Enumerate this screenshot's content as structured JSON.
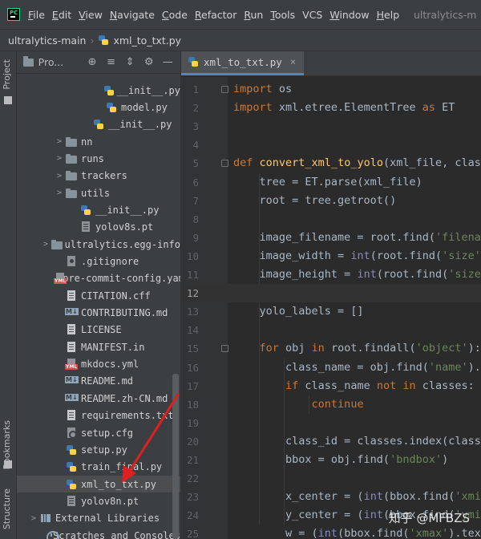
{
  "menubar": {
    "items": [
      {
        "mnemonic": "F",
        "rest": "ile"
      },
      {
        "mnemonic": "E",
        "rest": "dit"
      },
      {
        "mnemonic": "V",
        "rest": "iew"
      },
      {
        "mnemonic": "N",
        "rest": "avigate"
      },
      {
        "mnemonic": "C",
        "rest": "ode"
      },
      {
        "mnemonic": "R",
        "rest": "efactor"
      },
      {
        "mnemonic": "R",
        "rest": "un"
      },
      {
        "mnemonic": "T",
        "rest": "ools"
      },
      {
        "mnemonic": "",
        "rest": "VCS"
      },
      {
        "mnemonic": "W",
        "rest": "indow"
      },
      {
        "mnemonic": "H",
        "rest": "elp"
      }
    ],
    "window_title": "ultralytics-m"
  },
  "breadcrumbs": {
    "project": "ultralytics-main",
    "file": "xml_to_txt.py"
  },
  "left_strip": {
    "project": "Project",
    "bookmarks": "Bookmarks",
    "structure": "Structure"
  },
  "project_panel": {
    "title": "Pro...",
    "tree": [
      {
        "name": "__init__.py",
        "icon": "python-file-icon",
        "arrow": ""
      },
      {
        "name": "model.py",
        "icon": "python-file-icon",
        "arrow": ""
      },
      {
        "name": "__init__.py",
        "icon": "python-file-icon",
        "arrow": ""
      },
      {
        "name": "nn",
        "icon": "folder-icon",
        "arrow": ">"
      },
      {
        "name": "runs",
        "icon": "folder-icon",
        "arrow": ">"
      },
      {
        "name": "trackers",
        "icon": "folder-icon",
        "arrow": ">"
      },
      {
        "name": "utils",
        "icon": "folder-icon",
        "arrow": ">"
      },
      {
        "name": "__init__.py",
        "icon": "python-file-icon",
        "arrow": ""
      },
      {
        "name": "yolov8s.pt",
        "icon": "pt-file-icon",
        "arrow": ""
      },
      {
        "name": "ultralytics.egg-info",
        "icon": "folder-icon",
        "arrow": ">"
      },
      {
        "name": ".gitignore",
        "icon": "gitignore-icon",
        "arrow": ""
      },
      {
        "name": ".pre-commit-config.yaml",
        "icon": "yaml-file-icon",
        "arrow": ""
      },
      {
        "name": "CITATION.cff",
        "icon": "text-file-icon",
        "arrow": ""
      },
      {
        "name": "CONTRIBUTING.md",
        "icon": "markdown-file-icon",
        "arrow": ""
      },
      {
        "name": "LICENSE",
        "icon": "text-file-icon",
        "arrow": ""
      },
      {
        "name": "MANIFEST.in",
        "icon": "text-file-icon",
        "arrow": ""
      },
      {
        "name": "mkdocs.yml",
        "icon": "yaml-file-icon",
        "arrow": ""
      },
      {
        "name": "README.md",
        "icon": "markdown-file-icon",
        "arrow": ""
      },
      {
        "name": "README.zh-CN.md",
        "icon": "markdown-file-icon",
        "arrow": ""
      },
      {
        "name": "requirements.txt",
        "icon": "text-file-icon",
        "arrow": ""
      },
      {
        "name": "setup.cfg",
        "icon": "config-file-icon",
        "arrow": ""
      },
      {
        "name": "setup.py",
        "icon": "python-file-icon",
        "arrow": ""
      },
      {
        "name": "train_final.py",
        "icon": "python-file-icon",
        "arrow": ""
      },
      {
        "name": "xml_to_txt.py",
        "icon": "python-file-icon",
        "arrow": "",
        "selected": true
      },
      {
        "name": "yolov8n.pt",
        "icon": "pt-file-icon",
        "arrow": ""
      },
      {
        "name": "External Libraries",
        "icon": "library-icon",
        "arrow": ">"
      },
      {
        "name": "Scratches and Consoles",
        "icon": "scratch-icon",
        "arrow": ""
      }
    ]
  },
  "editor": {
    "tab": {
      "label": "xml_to_txt.py"
    },
    "current_line": 12,
    "lines": [
      {
        "n": "1",
        "tokens": [
          [
            "kw",
            "import"
          ],
          [
            "",
            " os"
          ]
        ]
      },
      {
        "n": "2",
        "tokens": [
          [
            "kw",
            "import"
          ],
          [
            "",
            " xml.etree.ElementTree "
          ],
          [
            "kw",
            "as"
          ],
          [
            "",
            " ET"
          ]
        ]
      },
      {
        "n": "3",
        "tokens": []
      },
      {
        "n": "4",
        "tokens": []
      },
      {
        "n": "5",
        "tokens": [
          [
            "kw",
            "def"
          ],
          [
            "",
            " "
          ],
          [
            "fn",
            "convert_xml_to_yolo"
          ],
          [
            "",
            "(xml_file, classe"
          ]
        ]
      },
      {
        "n": "6",
        "tokens": [
          [
            "",
            "    tree = ET.parse(xml_file)"
          ]
        ]
      },
      {
        "n": "7",
        "tokens": [
          [
            "",
            "    root = tree.getroot()"
          ]
        ]
      },
      {
        "n": "8",
        "tokens": []
      },
      {
        "n": "9",
        "tokens": [
          [
            "",
            "    image_filename = root.find("
          ],
          [
            "str",
            "'filename"
          ]
        ]
      },
      {
        "n": "10",
        "tokens": [
          [
            "",
            "    image_width = "
          ],
          [
            "builtin",
            "int"
          ],
          [
            "",
            "(root.find("
          ],
          [
            "str",
            "'size'"
          ],
          [
            "",
            ")."
          ]
        ]
      },
      {
        "n": "11",
        "tokens": [
          [
            "",
            "    image_height = "
          ],
          [
            "builtin",
            "int"
          ],
          [
            "",
            "(root.find("
          ],
          [
            "str",
            "'size'"
          ],
          [
            "",
            ")"
          ]
        ]
      },
      {
        "n": "12",
        "tokens": []
      },
      {
        "n": "13",
        "tokens": [
          [
            "",
            "    yolo_labels = []"
          ]
        ]
      },
      {
        "n": "14",
        "tokens": []
      },
      {
        "n": "15",
        "tokens": [
          [
            "",
            "    "
          ],
          [
            "kw",
            "for"
          ],
          [
            "",
            " obj "
          ],
          [
            "kw",
            "in"
          ],
          [
            "",
            " root.findall("
          ],
          [
            "str",
            "'object'"
          ],
          [
            "",
            "):"
          ]
        ]
      },
      {
        "n": "16",
        "tokens": [
          [
            "",
            "        class_name = obj.find("
          ],
          [
            "str",
            "'name'"
          ],
          [
            "",
            ").te"
          ]
        ]
      },
      {
        "n": "17",
        "tokens": [
          [
            "",
            "        "
          ],
          [
            "kw",
            "if"
          ],
          [
            "",
            " class_name "
          ],
          [
            "kw",
            "not in"
          ],
          [
            "",
            " classes:"
          ]
        ]
      },
      {
        "n": "18",
        "tokens": [
          [
            "",
            "            "
          ],
          [
            "kw",
            "continue"
          ]
        ]
      },
      {
        "n": "19",
        "tokens": []
      },
      {
        "n": "20",
        "tokens": [
          [
            "",
            "        class_id = classes.index(class_n"
          ]
        ]
      },
      {
        "n": "21",
        "tokens": [
          [
            "",
            "        bbox = obj.find("
          ],
          [
            "str",
            "'bndbox'"
          ],
          [
            "",
            ")"
          ]
        ]
      },
      {
        "n": "22",
        "tokens": []
      },
      {
        "n": "23",
        "tokens": [
          [
            "",
            "        x_center = ("
          ],
          [
            "builtin",
            "int"
          ],
          [
            "",
            "(bbox.find("
          ],
          [
            "str",
            "'xmin'"
          ]
        ]
      },
      {
        "n": "24",
        "tokens": [
          [
            "",
            "        y_center = ("
          ],
          [
            "builtin",
            "int"
          ],
          [
            "",
            "(bbox.find("
          ],
          [
            "str",
            "'ymin'"
          ]
        ]
      },
      {
        "n": "25",
        "tokens": [
          [
            "",
            "        w = ("
          ],
          [
            "builtin",
            "int"
          ],
          [
            "",
            "(bbox.find("
          ],
          [
            "str",
            "'xmax'"
          ],
          [
            "",
            ").text"
          ]
        ]
      }
    ]
  },
  "watermark": "知乎 @MFBZS",
  "colors": {
    "keyword": "#cc7832",
    "function": "#ffc66d",
    "string": "#6a8759",
    "builtin": "#8888c6",
    "annotation_arrow": "#e02020",
    "selection": "#4b4d4f"
  }
}
